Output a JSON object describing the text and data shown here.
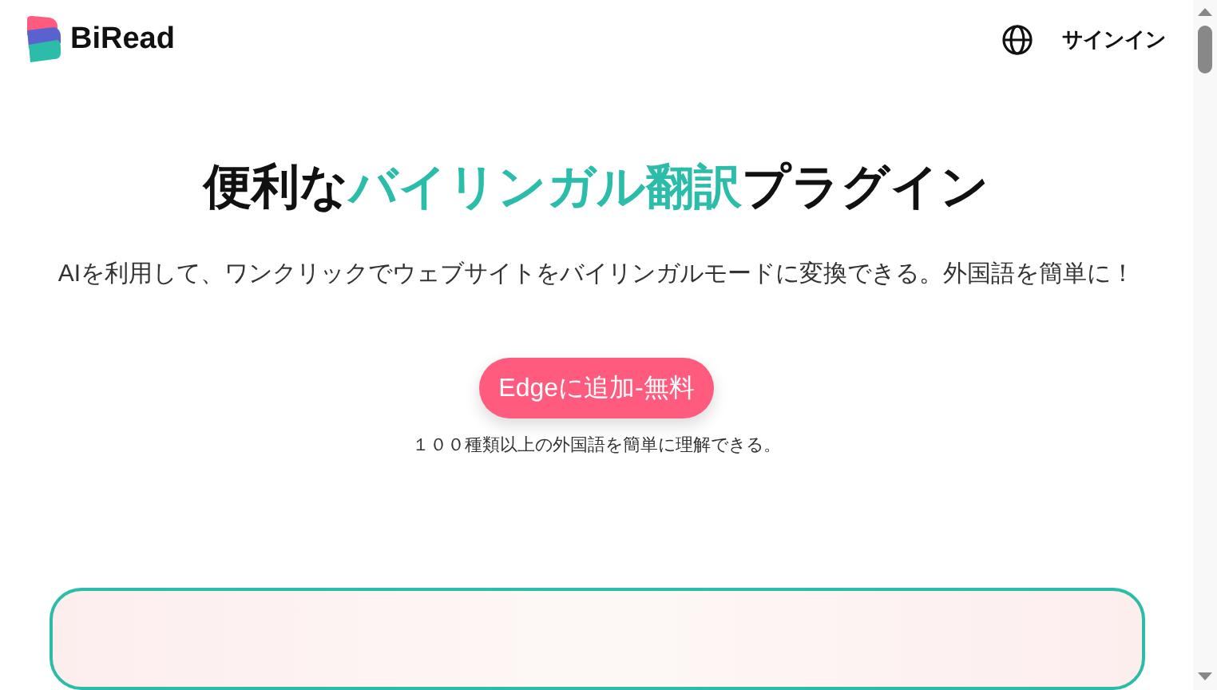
{
  "header": {
    "brand": "BiRead",
    "signin": "サインイン"
  },
  "hero": {
    "headline": [
      {
        "text": "便利な",
        "highlighted": false
      },
      {
        "text": "バイリンガル翻訳",
        "highlighted": true
      },
      {
        "text": "プラグイン",
        "highlighted": false
      }
    ],
    "subtitle": "AIを利用して、ワンクリックでウェブサイトをバイリンガルモードに変換できる。外国語を簡単に！",
    "cta": "Edgeに追加-無料",
    "note": "１００種類以上の外国語を簡単に理解できる。"
  }
}
